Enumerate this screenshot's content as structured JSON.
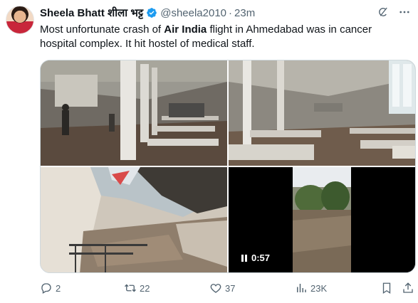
{
  "author": {
    "display_name": "Sheela Bhatt शीला भट्ट",
    "handle": "@sheela2010",
    "time": "23m",
    "separator": "·"
  },
  "tweet": {
    "text_pre": "Most unfortunate crash of ",
    "text_bold": "Air India",
    "text_post": " flight in Ahmedabad was in cancer hospital complex. It hit hostel of medical staff."
  },
  "video": {
    "duration": "0:57"
  },
  "stats": {
    "replies": "2",
    "reposts": "22",
    "likes": "37",
    "views": "23K"
  },
  "colors": {
    "verified": "#1d9bf0",
    "muted": "#536471",
    "text": "#0f1419"
  },
  "icons": {
    "reply": "reply-icon",
    "repost": "repost-icon",
    "like": "heart-icon",
    "views": "views-icon",
    "bookmark": "bookmark-icon",
    "share": "share-icon",
    "grok": "grok-icon",
    "more": "more-icon"
  }
}
